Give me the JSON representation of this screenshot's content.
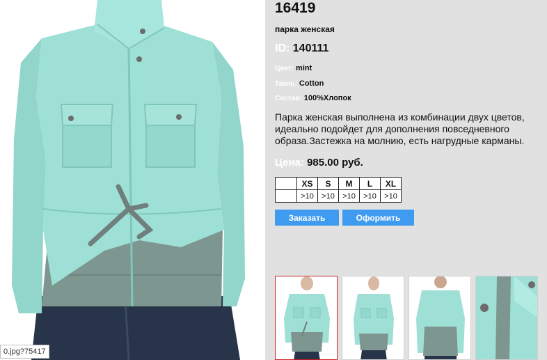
{
  "product": {
    "sku": "16419",
    "subtitle": "парка женская",
    "id_label": "ID:",
    "id_value": "140111",
    "attributes": [
      {
        "label": "Цвет:",
        "value": "mint"
      },
      {
        "label": "Ткань:",
        "value": "Cotton"
      },
      {
        "label": "Состав:",
        "value": "100%Хлопок"
      }
    ],
    "description": "Парка женская выполнена из комбинации двух цветов, идеально подойдет для дополнения повседневного образа.Застежка на молнию, есть нагрудные карманы.",
    "price_label": "Цена:",
    "price_value": "985.00 руб."
  },
  "sizes": {
    "headers": [
      "XS",
      "S",
      "M",
      "L",
      "XL"
    ],
    "stock": [
      ">10",
      ">10",
      ">10",
      ">10",
      ">10"
    ]
  },
  "buttons": {
    "order": "Заказать",
    "checkout": "Оформить"
  },
  "main_image": {
    "caption": "0.jpg?75417"
  },
  "colors": {
    "background": "#e1e1e1",
    "button": "#3f9bf0",
    "jacket_mint": "#9fe0d6",
    "jacket_grey": "#7e9690",
    "jeans": "#27344a",
    "thumb_active_border": "#d01e1e"
  }
}
